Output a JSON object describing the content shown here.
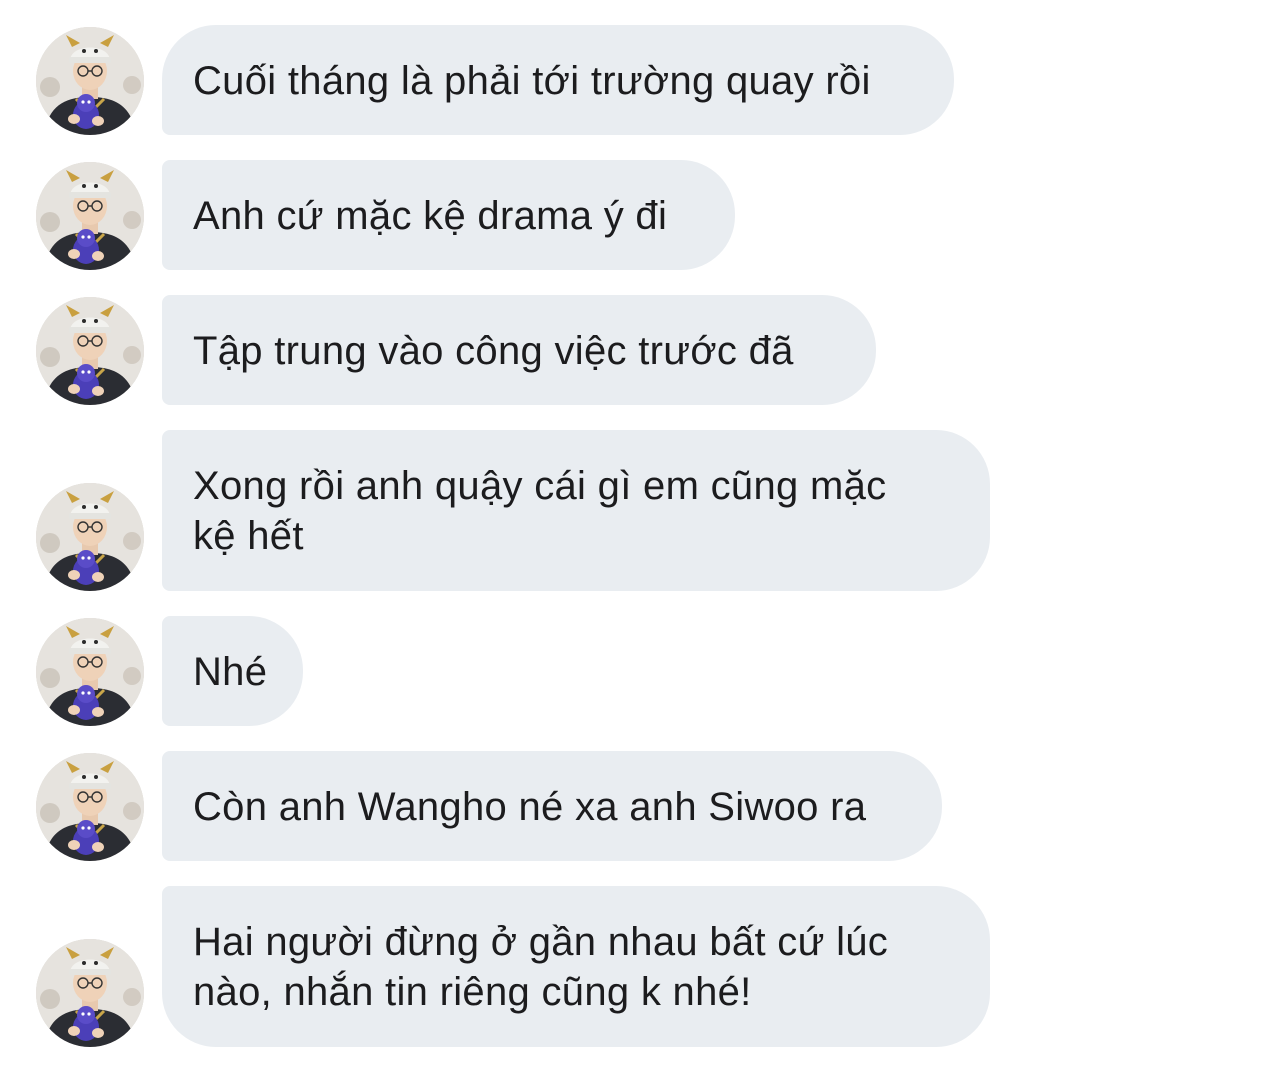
{
  "conversation": {
    "messages": [
      {
        "text": "Cuối tháng là phải tới trường quay rồi"
      },
      {
        "text": "Anh cứ mặc kệ drama ý đi"
      },
      {
        "text": "Tập trung vào công việc trước đã"
      },
      {
        "text": "Xong rồi anh quậy cái gì em cũng mặc\nkệ hết"
      },
      {
        "text": "Nhé"
      },
      {
        "text": "Còn anh Wangho né xa anh Siwoo ra"
      },
      {
        "text": "Hai người đừng ở gần nhau bất cứ lúc\nnào, nhắn tin riêng cũng k nhé!"
      }
    ]
  },
  "colors": {
    "bubble_bg": "#e9edf1",
    "text": "#1c1c1e",
    "background": "#ffffff"
  },
  "icons": {
    "avatar": "sender-avatar-photo"
  }
}
